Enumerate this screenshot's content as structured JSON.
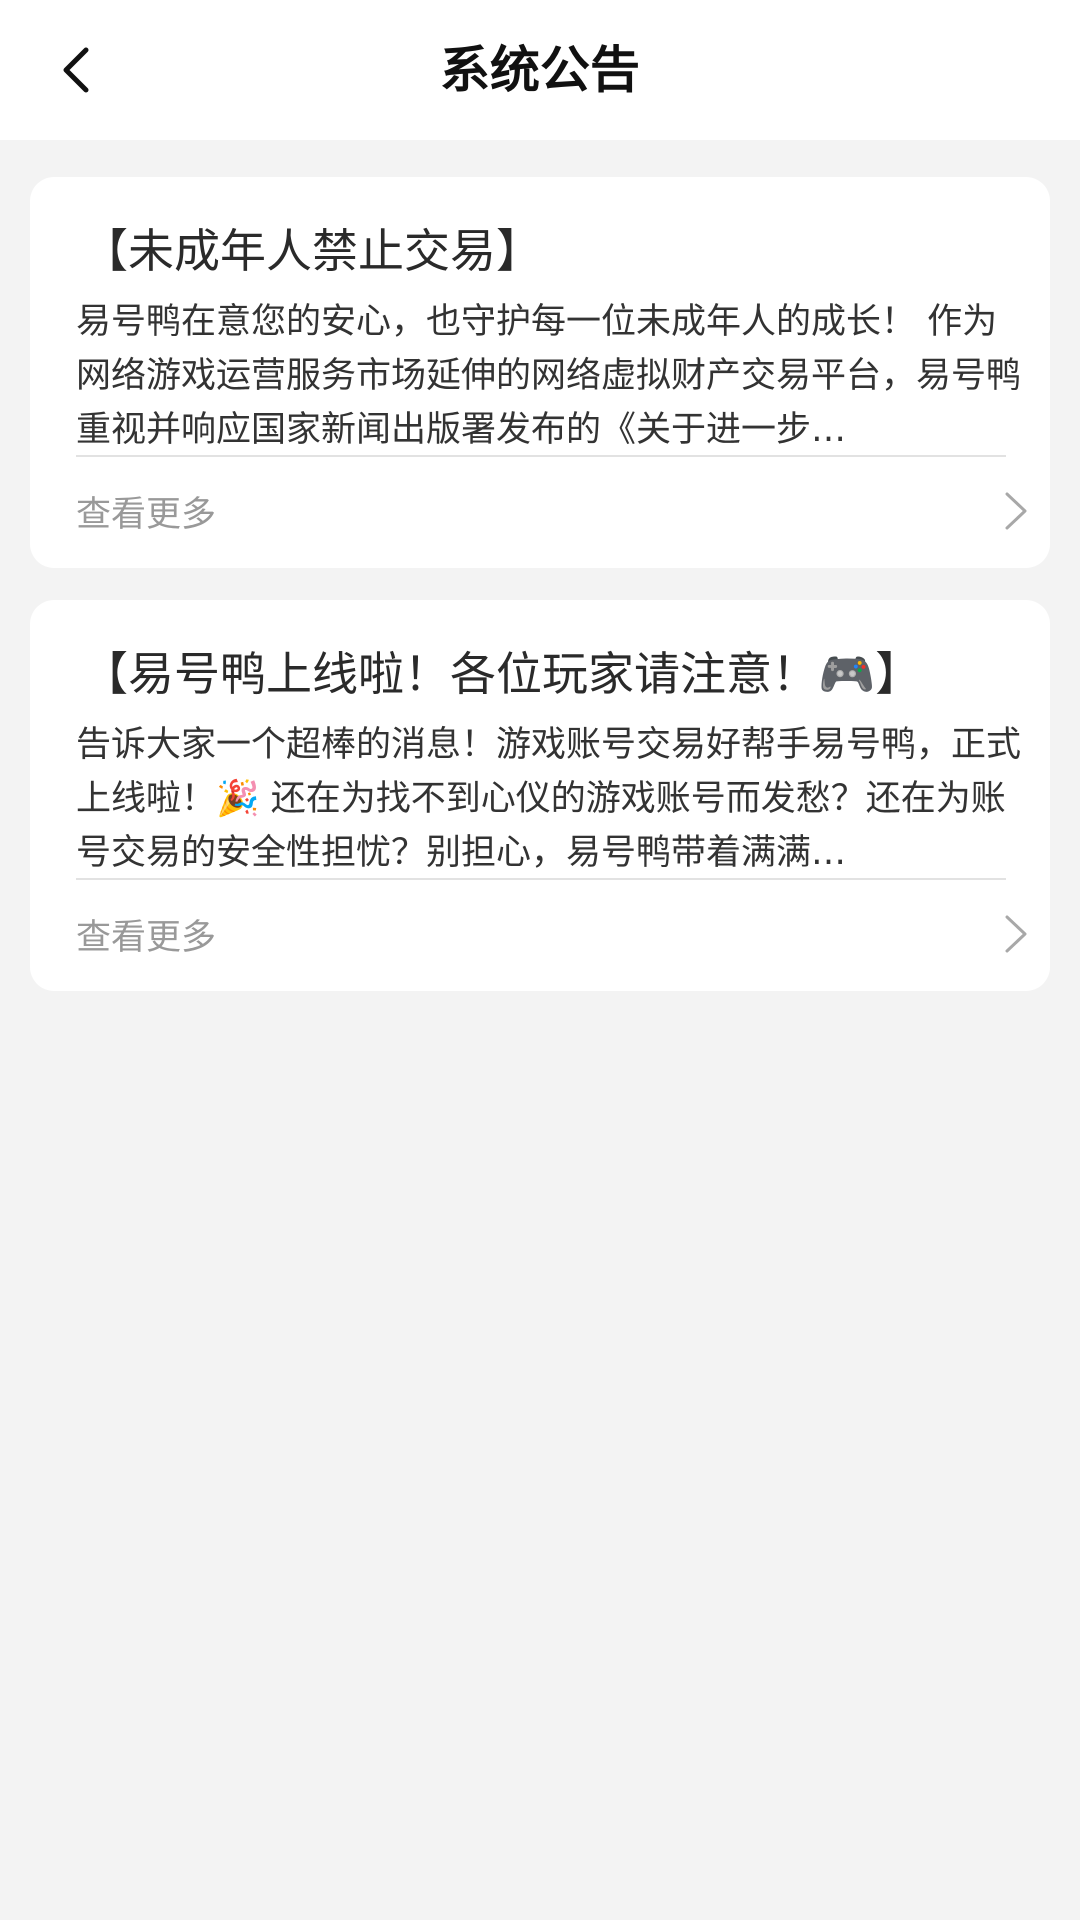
{
  "header": {
    "title": "系统公告",
    "back_icon": "chevron-left-icon"
  },
  "announcements": [
    {
      "title": "【未成年人禁止交易】",
      "body": "易号鸭在意您的安心，也守护每一位未成年人的成长！ 作为网络游戏运营服务市场延伸的网络虚拟财产交易平台，易号鸭重视并响应国家新闻出版署发布的《关于进一步…",
      "more_label": "查看更多",
      "more_icon": "chevron-right-icon"
    },
    {
      "title": "【易号鸭上线啦！各位玩家请注意！🎮】",
      "body": "告诉大家一个超棒的消息！游戏账号交易好帮手易号鸭，正式上线啦！🎉 还在为找不到心仪的游戏账号而发愁？还在为账号交易的安全性担忧？别担心，易号鸭带着满满…",
      "more_label": "查看更多",
      "more_icon": "chevron-right-icon"
    }
  ]
}
